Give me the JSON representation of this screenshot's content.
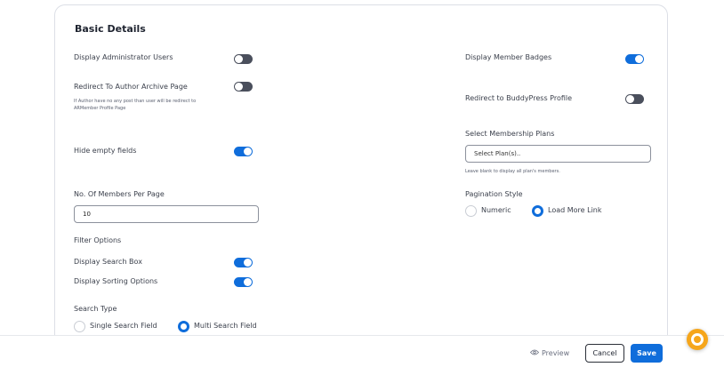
{
  "section": {
    "title": "Basic Details"
  },
  "left": {
    "display_admin_users": {
      "label": "Display Administrator Users",
      "enabled": false
    },
    "redirect_author_archive": {
      "label": "Redirect To Author Archive Page",
      "hint_line1": "If Author have no any post than user will be redirect to",
      "hint_line2": "ARMember Profile Page",
      "enabled": false
    },
    "hide_empty_fields": {
      "label": "Hide empty fields",
      "enabled": true
    },
    "members_per_page": {
      "label": "No. Of Members Per Page",
      "value": "10"
    },
    "filter_options": {
      "label": "Filter Options"
    },
    "display_search_box": {
      "label": "Display Search Box",
      "enabled": true
    },
    "display_sorting_options": {
      "label": "Display Sorting Options",
      "enabled": true
    },
    "search_type": {
      "label": "Search Type",
      "options": [
        "Single Search Field",
        "Multi Search Field"
      ],
      "selected": "Multi Search Field"
    }
  },
  "right": {
    "display_member_badges": {
      "label": "Display Member Badges",
      "enabled": true
    },
    "redirect_buddypress": {
      "label": "Redirect to BuddyPress Profile",
      "enabled": false
    },
    "membership_plans": {
      "label": "Select Membership Plans",
      "placeholder": "Select Plan(s)..",
      "hint": "Leave blank to display all plan's members."
    },
    "pagination_style": {
      "label": "Pagination Style",
      "options": [
        "Numeric",
        "Load More Link"
      ],
      "selected": "Load More Link"
    }
  },
  "footer": {
    "preview_label": "Preview",
    "cancel_label": "Cancel",
    "save_label": "Save"
  },
  "colors": {
    "accent": "#0f6ddb",
    "toggle_off": "#4a4f5c",
    "help_button": "#f6a61b"
  }
}
